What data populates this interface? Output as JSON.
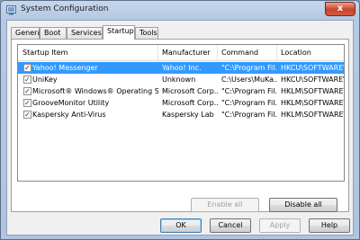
{
  "window": {
    "title": "System Configuration",
    "close_glyph": "x"
  },
  "tabs": [
    "General",
    "Boot",
    "Services",
    "Startup",
    "Tools"
  ],
  "active_tab": "Startup",
  "startup_table": {
    "columns": [
      "Startup Item",
      "Manufacturer",
      "Command",
      "Location"
    ],
    "rows": [
      {
        "checked": true,
        "item": "Yahoo! Messenger",
        "manufacturer": "Yahoo! Inc.",
        "command": "\"C:\\Program Fil...",
        "location": "HKCU\\SOFTWARE\\...",
        "selected": true
      },
      {
        "checked": true,
        "item": "UniKey",
        "manufacturer": "Unknown",
        "command": "C:\\Users\\MuKa...",
        "location": "HKCU\\SOFTWARE\\...",
        "selected": false
      },
      {
        "checked": true,
        "item": "Microsoft® Windows® Operating System",
        "manufacturer": "Microsoft Corp...",
        "command": "\"C:\\Program Fil...",
        "location": "HKLM\\SOFTWARE\\...",
        "selected": false
      },
      {
        "checked": true,
        "item": "GrooveMonitor Utility",
        "manufacturer": "Microsoft Corp...",
        "command": "\"C:\\Program Fil...",
        "location": "HKLM\\SOFTWARE\\...",
        "selected": false
      },
      {
        "checked": true,
        "item": "Kaspersky Anti-Virus",
        "manufacturer": "Kaspersky Lab",
        "command": "\"C:\\Program Fil...",
        "location": "HKLM\\SOFTWARE\\...",
        "selected": false
      }
    ]
  },
  "panel_buttons": {
    "enable_all": "Enable all",
    "disable_all": "Disable all"
  },
  "dialog_buttons": {
    "ok": "OK",
    "cancel": "Cancel",
    "apply": "Apply",
    "help": "Help"
  },
  "colors": {
    "selection": "#3399ff",
    "title_bar": "#c6d7ec",
    "close_button": "#c7442a"
  },
  "icons": {
    "app": "system-configuration-icon",
    "close": "close-icon",
    "check": "checkmark-icon"
  }
}
